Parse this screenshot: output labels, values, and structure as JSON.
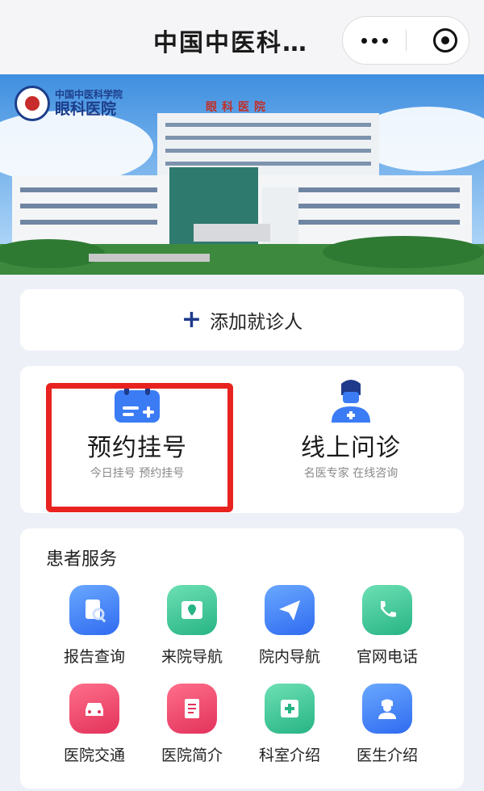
{
  "header": {
    "title": "中国中医科…"
  },
  "banner": {
    "logo_line1": "中国中医科学院",
    "logo_line2": "眼科医院",
    "roof_sign": "眼科医院"
  },
  "add_patient": {
    "icon": "plus-icon",
    "label": "添加就诊人"
  },
  "features": [
    {
      "title": "预约挂号",
      "subtitle": "今日挂号 预约挂号",
      "icon": "calendar-add-icon"
    },
    {
      "title": "线上问诊",
      "subtitle": "名医专家 在线咨询",
      "icon": "doctor-icon"
    }
  ],
  "services": {
    "title": "患者服务",
    "items": [
      {
        "label": "报告查询",
        "icon": "report-search-icon",
        "color": "blue"
      },
      {
        "label": "来院导航",
        "icon": "map-icon",
        "color": "green"
      },
      {
        "label": "院内导航",
        "icon": "paper-plane-icon",
        "color": "blue"
      },
      {
        "label": "官网电话",
        "icon": "phone-icon",
        "color": "green"
      },
      {
        "label": "医院交通",
        "icon": "car-icon",
        "color": "red"
      },
      {
        "label": "医院简介",
        "icon": "document-icon",
        "color": "red"
      },
      {
        "label": "科室介绍",
        "icon": "clinic-icon",
        "color": "green"
      },
      {
        "label": "医生介绍",
        "icon": "nurse-icon",
        "color": "blue"
      }
    ]
  },
  "colors": {
    "accent": "#1f3a8a",
    "highlight": "#e8231f",
    "blue_icon": "#3b7cf5",
    "green_icon": "#2fbf8c",
    "red_icon": "#e83c62"
  }
}
